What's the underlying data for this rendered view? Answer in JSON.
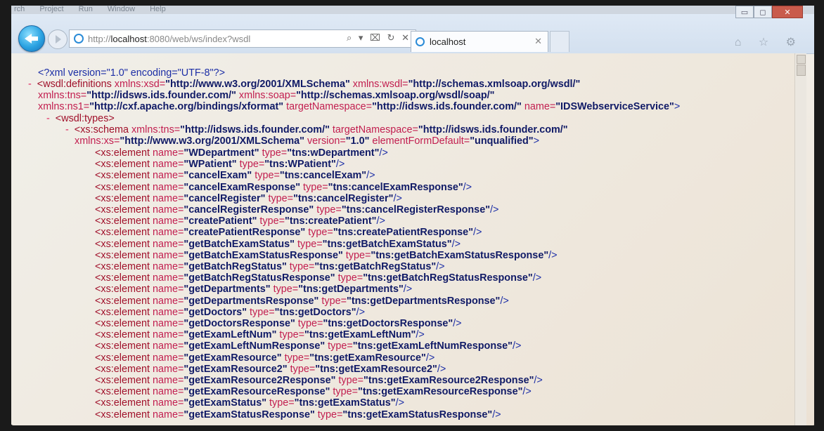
{
  "menubar": [
    "rch",
    "Project",
    "Run",
    "Window",
    "Help"
  ],
  "window": {
    "min_label": "▭",
    "max_label": "◻",
    "close_label": "✕"
  },
  "address": {
    "prefix": "http://",
    "host": "localhost",
    "rest": ":8080/web/ws/index?wsdl",
    "tools": "⌕ ▾ ⌧ ↻ ✕"
  },
  "tab": {
    "title": "localhost",
    "close": "✕"
  },
  "right_tools": "⌂ ☆ ⚙",
  "xml": {
    "decl": "<?xml version=\"1.0\" encoding=\"UTF-8\"?>",
    "def1_tag": "<wsdl:definitions ",
    "def1_attr1": "xmlns:xsd=",
    "def1_val1": "\"http://www.w3.org/2001/XMLSchema\"",
    "def1_attr2": " xmlns:wsdl=",
    "def1_val2": "\"http://schemas.xmlsoap.org/wsdl/\"",
    "def2_attr1": "xmlns:tns=",
    "def2_val1": "\"http://idsws.ids.founder.com/\"",
    "def2_attr2": " xmlns:soap=",
    "def2_val2": "\"http://schemas.xmlsoap.org/wsdl/soap/\"",
    "def3_attr1": "xmlns:ns1=",
    "def3_val1": "\"http://cxf.apache.org/bindings/xformat\"",
    "def3_attr2": " targetNamespace=",
    "def3_val2": "\"http://idsws.ids.founder.com/\"",
    "def3_attr3": " name=",
    "def3_val3": "\"IDSWebserviceService\"",
    "def3_end": ">",
    "types": "<wsdl:types>",
    "schema_tag": "<xs:schema ",
    "schema_attr1": "xmlns:tns=",
    "schema_val1": "\"http://idsws.ids.founder.com/\"",
    "schema_attr2": " targetNamespace=",
    "schema_val2": "\"http://idsws.ids.founder.com/\"",
    "schema2_attr1": "xmlns:xs=",
    "schema2_val1": "\"http://www.w3.org/2001/XMLSchema\"",
    "schema2_attr2": " version=",
    "schema2_val2": "\"1.0\"",
    "schema2_attr3": " elementFormDefault=",
    "schema2_val3": "\"unqualified\"",
    "schema2_end": ">",
    "minus": "-",
    "el_open": "<xs:element ",
    "el_name": "name=",
    "el_type": " type=",
    "el_close": "/>",
    "elements": [
      {
        "name": "\"WDepartment\"",
        "type": "\"tns:wDepartment\""
      },
      {
        "name": "\"WPatient\"",
        "type": "\"tns:WPatient\""
      },
      {
        "name": "\"cancelExam\"",
        "type": "\"tns:cancelExam\""
      },
      {
        "name": "\"cancelExamResponse\"",
        "type": "\"tns:cancelExamResponse\""
      },
      {
        "name": "\"cancelRegister\"",
        "type": "\"tns:cancelRegister\""
      },
      {
        "name": "\"cancelRegisterResponse\"",
        "type": "\"tns:cancelRegisterResponse\""
      },
      {
        "name": "\"createPatient\"",
        "type": "\"tns:createPatient\""
      },
      {
        "name": "\"createPatientResponse\"",
        "type": "\"tns:createPatientResponse\""
      },
      {
        "name": "\"getBatchExamStatus\"",
        "type": "\"tns:getBatchExamStatus\""
      },
      {
        "name": "\"getBatchExamStatusResponse\"",
        "type": "\"tns:getBatchExamStatusResponse\""
      },
      {
        "name": "\"getBatchRegStatus\"",
        "type": "\"tns:getBatchRegStatus\""
      },
      {
        "name": "\"getBatchRegStatusResponse\"",
        "type": "\"tns:getBatchRegStatusResponse\""
      },
      {
        "name": "\"getDepartments\"",
        "type": "\"tns:getDepartments\""
      },
      {
        "name": "\"getDepartmentsResponse\"",
        "type": "\"tns:getDepartmentsResponse\""
      },
      {
        "name": "\"getDoctors\"",
        "type": "\"tns:getDoctors\""
      },
      {
        "name": "\"getDoctorsResponse\"",
        "type": "\"tns:getDoctorsResponse\""
      },
      {
        "name": "\"getExamLeftNum\"",
        "type": "\"tns:getExamLeftNum\""
      },
      {
        "name": "\"getExamLeftNumResponse\"",
        "type": "\"tns:getExamLeftNumResponse\""
      },
      {
        "name": "\"getExamResource\"",
        "type": "\"tns:getExamResource\""
      },
      {
        "name": "\"getExamResource2\"",
        "type": "\"tns:getExamResource2\""
      },
      {
        "name": "\"getExamResource2Response\"",
        "type": "\"tns:getExamResource2Response\""
      },
      {
        "name": "\"getExamResourceResponse\"",
        "type": "\"tns:getExamResourceResponse\""
      },
      {
        "name": "\"getExamStatus\"",
        "type": "\"tns:getExamStatus\""
      },
      {
        "name": "\"getExamStatusResponse\"",
        "type": "\"tns:getExamStatusResponse\""
      }
    ]
  }
}
